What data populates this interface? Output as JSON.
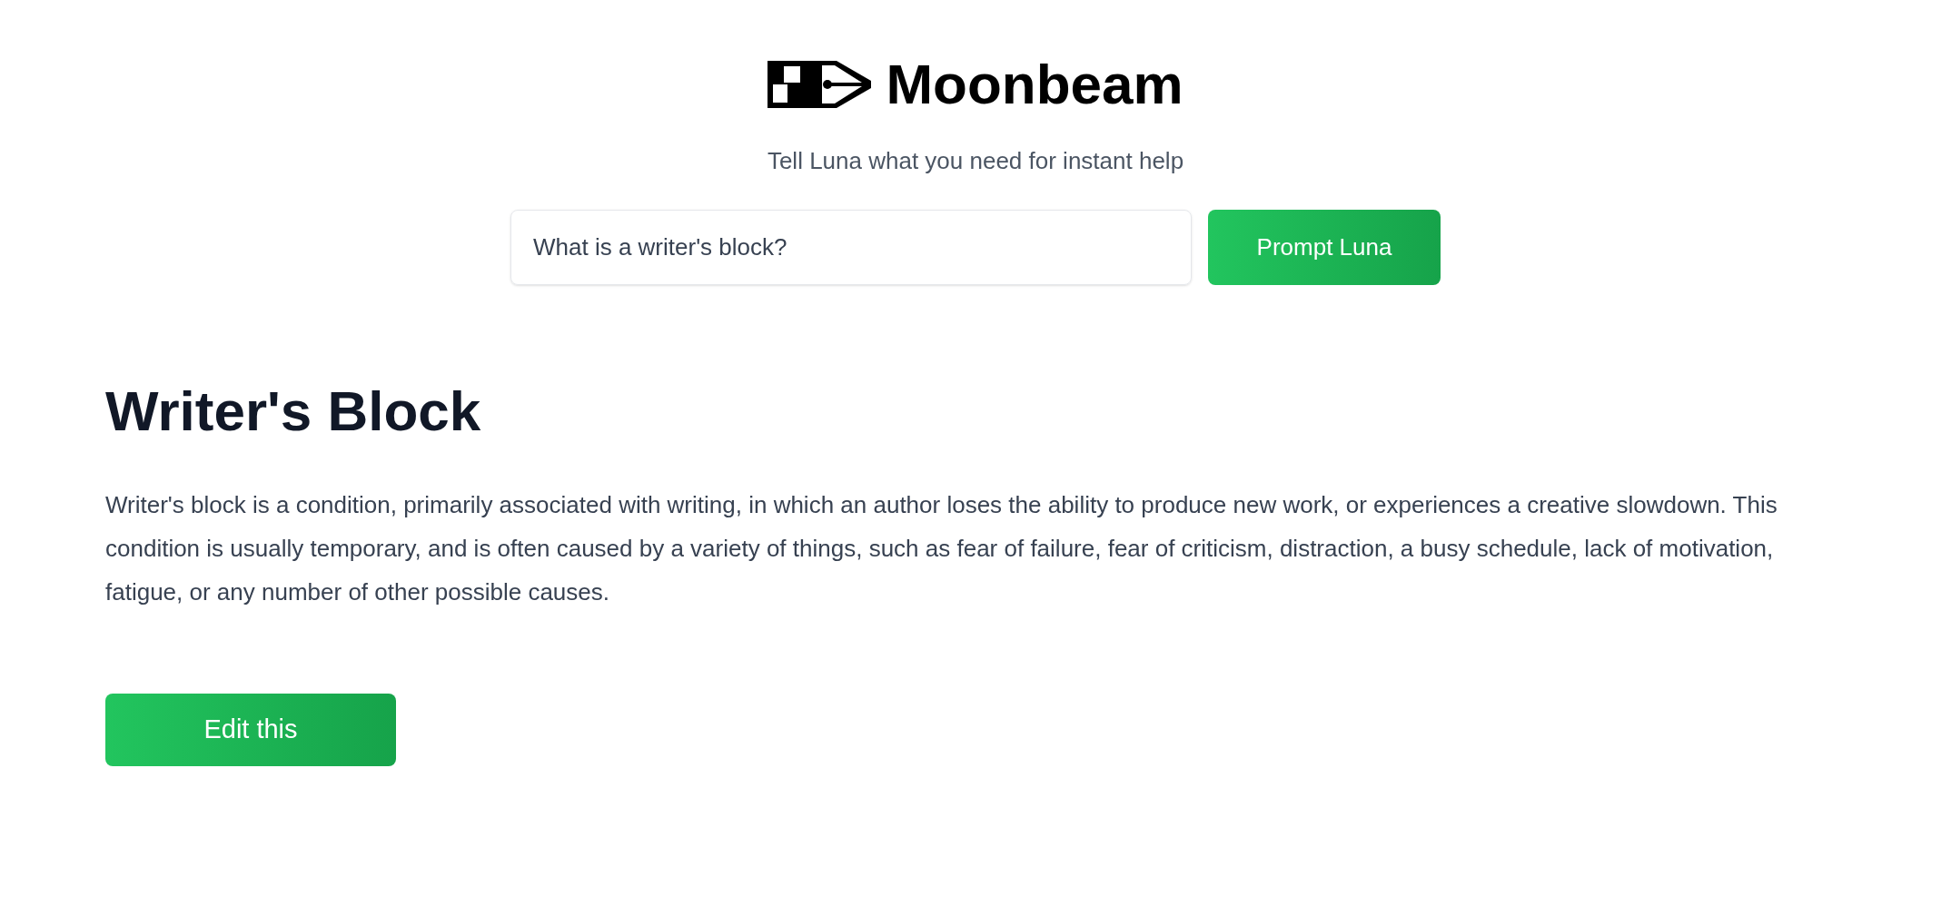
{
  "header": {
    "brand": "Moonbeam",
    "tagline": "Tell Luna what you need for instant help"
  },
  "prompt": {
    "value": "What is a writer's block?",
    "button": "Prompt Luna"
  },
  "answer": {
    "title": "Writer's Block",
    "body": "Writer's block is a condition, primarily associated with writing, in which an author loses the ability to produce new work, or experiences a creative slowdown. This condition is usually temporary, and is often caused by a variety of things, such as fear of failure, fear of criticism, distraction, a busy schedule, lack of motivation, fatigue, or any number of other possible causes.",
    "button": "Edit this"
  }
}
